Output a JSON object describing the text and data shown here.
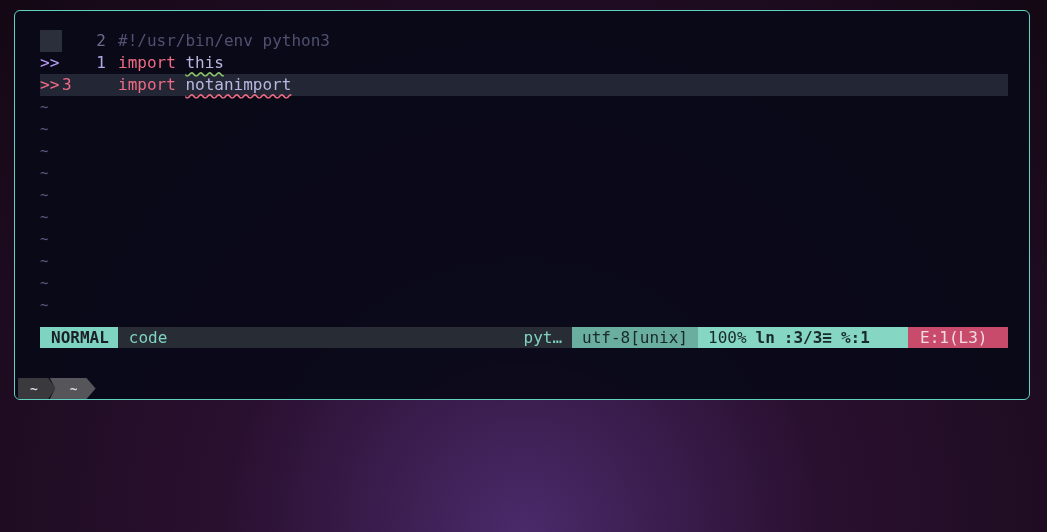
{
  "editor": {
    "lines": [
      {
        "sign": {
          "kind": "block"
        },
        "number": "2",
        "current": false,
        "tokens": [
          {
            "text": "#!/usr/bin/env python3",
            "kind": "comment",
            "warning": false,
            "error": false
          }
        ]
      },
      {
        "sign": {
          "text": ">>",
          "kind": "warning"
        },
        "number": "1",
        "current": false,
        "tokens": [
          {
            "text": "import",
            "kind": "keyword",
            "warning": false,
            "error": false
          },
          {
            "text": "this",
            "kind": "identifier",
            "warning": true,
            "error": false
          }
        ]
      },
      {
        "sign": {
          "text": ">>",
          "kind": "error"
        },
        "number": "3",
        "current": true,
        "tokens": [
          {
            "text": "import",
            "kind": "keyword",
            "warning": false,
            "error": false
          },
          {
            "text": "notanimport",
            "kind": "identifier",
            "warning": false,
            "error": true
          }
        ]
      }
    ],
    "filler": [
      "~",
      "~",
      "~",
      "~",
      "~",
      "~",
      "~",
      "~",
      "~",
      "~"
    ]
  },
  "status_bar": {
    "mode": "NORMAL",
    "filename": "code",
    "filetype": "pyt…",
    "encoding": "utf-8[unix]",
    "position": [
      {
        "text": "100%",
        "kind": "plain"
      },
      {
        "text": "ln",
        "kind": "bold"
      },
      {
        "text": ":3/3≡",
        "kind": "bold"
      },
      {
        "text": "%:1",
        "kind": "bold"
      }
    ],
    "errors": "E:1(L3)"
  },
  "tabs": [
    {
      "label": "~",
      "selected": false
    },
    {
      "label": "~",
      "selected": true
    }
  ]
}
